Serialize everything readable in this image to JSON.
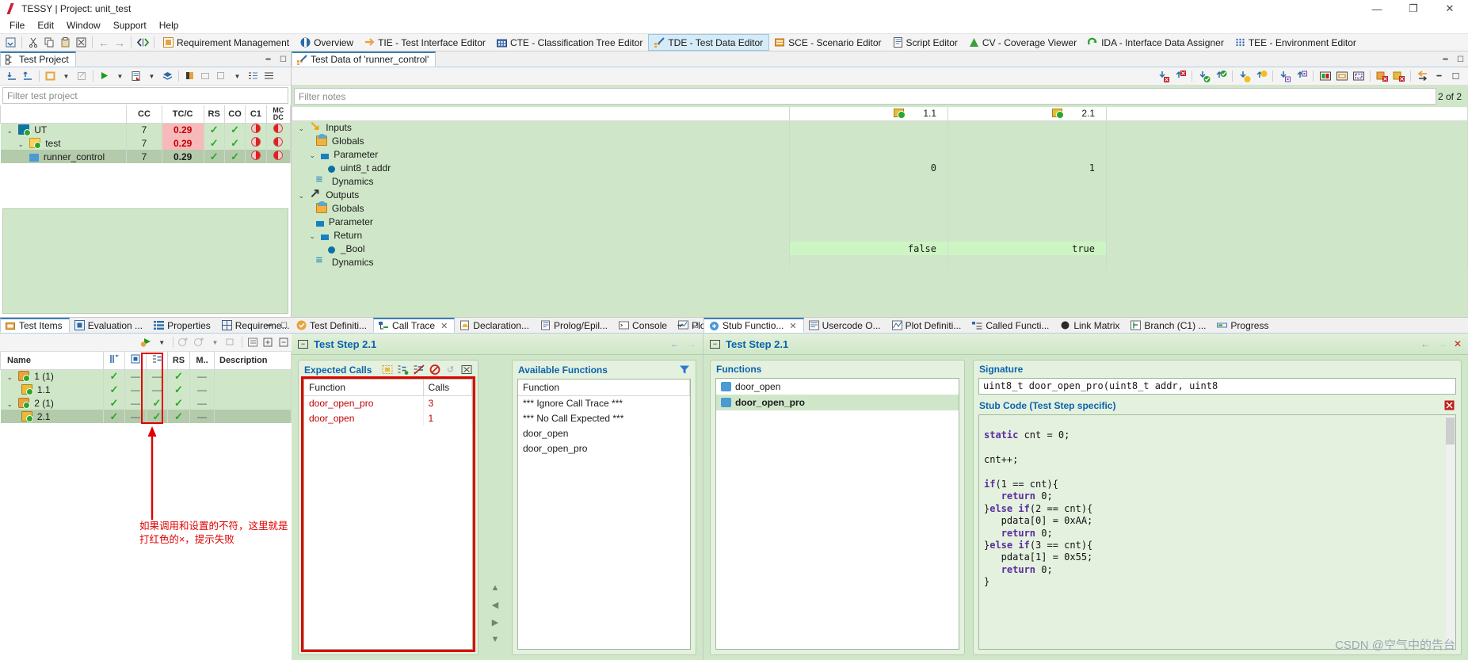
{
  "window": {
    "title": "TESSY | Project: unit_test",
    "minimize": "—",
    "maximize": "❐",
    "close": "✕"
  },
  "menu": [
    "File",
    "Edit",
    "Window",
    "Support",
    "Help"
  ],
  "perspectives": [
    {
      "label": "Requirement Management",
      "icon": "requirement-icon",
      "active": false
    },
    {
      "label": "Overview",
      "icon": "overview-icon",
      "active": false
    },
    {
      "label": "TIE - Test Interface Editor",
      "icon": "tie-icon",
      "active": false
    },
    {
      "label": "CTE - Classification Tree Editor",
      "icon": "cte-icon",
      "active": false
    },
    {
      "label": "TDE - Test Data Editor",
      "icon": "tde-icon",
      "active": true
    },
    {
      "label": "SCE - Scenario Editor",
      "icon": "sce-icon",
      "active": false
    },
    {
      "label": "Script Editor",
      "icon": "script-icon",
      "active": false
    },
    {
      "label": "CV - Coverage Viewer",
      "icon": "cv-icon",
      "active": false
    },
    {
      "label": "IDA - Interface Data Assigner",
      "icon": "ida-icon",
      "active": false
    },
    {
      "label": "TEE - Environment Editor",
      "icon": "tee-icon",
      "active": false
    }
  ],
  "test_project": {
    "tab_label": "Test Project",
    "filter_placeholder": "Filter test project",
    "columns": [
      "",
      "CC",
      "TC/C",
      "RS",
      "CO",
      "C1",
      "MC DC"
    ],
    "rows": [
      {
        "indent": 0,
        "expander": "⌄",
        "icon": "module-icon",
        "name": "UT",
        "cc": "7",
        "tcc": "0.29",
        "rs": "check",
        "co": "check",
        "c1": "pie-half",
        "mcdc": "pie-full",
        "selected": false
      },
      {
        "indent": 1,
        "expander": "⌄",
        "icon": "folder-icon",
        "name": "test",
        "cc": "7",
        "tcc": "0.29",
        "rs": "check",
        "co": "check",
        "c1": "pie-half",
        "mcdc": "pie-full",
        "selected": false
      },
      {
        "indent": 2,
        "expander": "",
        "icon": "function-icon",
        "name": "runner_control",
        "cc": "7",
        "tcc": "0.29",
        "rs": "check",
        "co": "check",
        "c1": "pie-half",
        "mcdc": "pie-full",
        "selected": true
      }
    ]
  },
  "test_data_editor": {
    "tab_label": "Test Data of 'runner_control'",
    "filter_placeholder": "Filter notes",
    "pager": "2 of 2",
    "step_columns": [
      "1.1",
      "2.1"
    ],
    "tree": [
      {
        "indent": 0,
        "expander": "⌄",
        "icon": "inputs-icon",
        "name": "Inputs",
        "v1": "",
        "v2": ""
      },
      {
        "indent": 1,
        "expander": "",
        "icon": "globals-icon",
        "name": "Globals",
        "v1": "",
        "v2": ""
      },
      {
        "indent": 1,
        "expander": "⌄",
        "icon": "parameter-icon",
        "name": "Parameter",
        "v1": "",
        "v2": ""
      },
      {
        "indent": 2,
        "expander": "",
        "icon": "variable-icon",
        "name": "uint8_t addr",
        "v1": "0",
        "v2": "1"
      },
      {
        "indent": 1,
        "expander": "",
        "icon": "dynamics-icon",
        "name": "Dynamics",
        "v1": "",
        "v2": ""
      },
      {
        "indent": 0,
        "expander": "⌄",
        "icon": "outputs-icon",
        "name": "Outputs",
        "v1": "",
        "v2": ""
      },
      {
        "indent": 1,
        "expander": "",
        "icon": "globals-icon",
        "name": "Globals",
        "v1": "",
        "v2": ""
      },
      {
        "indent": 1,
        "expander": "",
        "icon": "parameter-icon",
        "name": "Parameter",
        "v1": "",
        "v2": ""
      },
      {
        "indent": 1,
        "expander": "⌄",
        "icon": "return-icon",
        "name": "Return",
        "v1": "",
        "v2": ""
      },
      {
        "indent": 2,
        "expander": "",
        "icon": "variable-icon",
        "name": "_Bool",
        "v1": "false",
        "v2": "true",
        "highlight": true
      },
      {
        "indent": 1,
        "expander": "",
        "icon": "dynamics-icon",
        "name": "Dynamics",
        "v1": "",
        "v2": ""
      }
    ]
  },
  "test_items": {
    "tabs": [
      {
        "label": "Test Items",
        "icon": "test-items-icon",
        "active": true
      },
      {
        "label": "Evaluation ...",
        "icon": "evaluation-icon",
        "active": false
      },
      {
        "label": "Properties",
        "icon": "properties-icon",
        "active": false
      },
      {
        "label": "Requireme...",
        "icon": "requirements-icon",
        "active": false
      }
    ],
    "columns": [
      "Name",
      "",
      "",
      "",
      "RS",
      "M..",
      "Description"
    ],
    "rows": [
      {
        "indent": 0,
        "expander": "⌄",
        "icon": "testcase-icon",
        "name": "1 (1)",
        "c1": "check",
        "c2": "dash",
        "c3": "dash",
        "rs": "check",
        "m": "dash",
        "description": "",
        "selected": false
      },
      {
        "indent": 1,
        "expander": "",
        "icon": "teststep-icon",
        "name": "1.1",
        "c1": "check",
        "c2": "dash",
        "c3": "dash",
        "rs": "check",
        "m": "dash",
        "description": "",
        "selected": false
      },
      {
        "indent": 0,
        "expander": "⌄",
        "icon": "testcase-icon",
        "name": "2 (1)",
        "c1": "check",
        "c2": "dash",
        "c3": "check",
        "rs": "check",
        "m": "dash",
        "description": "",
        "selected": false
      },
      {
        "indent": 1,
        "expander": "",
        "icon": "teststep-icon",
        "name": "2.1",
        "c1": "check",
        "c2": "dash",
        "c3": "check",
        "rs": "check",
        "m": "dash",
        "description": "",
        "selected": true
      }
    ],
    "annotation_line1": "如果调用和设置的不符，这里就是",
    "annotation_line2": "打红色的×，提示失败"
  },
  "call_trace": {
    "tabs": [
      {
        "label": "Test Definiti...",
        "icon": "test-definition-icon",
        "active": false
      },
      {
        "label": "Call Trace",
        "icon": "call-trace-icon",
        "active": true,
        "closeable": true
      },
      {
        "label": "Declaration...",
        "icon": "declaration-icon",
        "active": false
      },
      {
        "label": "Prolog/Epil...",
        "icon": "prolog-epilog-icon",
        "active": false
      },
      {
        "label": "Console",
        "icon": "console-icon",
        "active": false
      },
      {
        "label": "Plots",
        "icon": "plots-icon",
        "active": false
      }
    ],
    "step_title": "Test Step 2.1",
    "expected_calls": {
      "title": "Expected Calls",
      "columns": [
        "Function",
        "Calls"
      ],
      "rows": [
        {
          "function": "door_open_pro",
          "calls": "3"
        },
        {
          "function": "door_open",
          "calls": "1"
        }
      ]
    },
    "available_functions": {
      "title": "Available Functions",
      "column": "Function",
      "rows": [
        "*** Ignore Call Trace ***",
        "*** No Call Expected ***",
        "door_open",
        "door_open_pro"
      ]
    }
  },
  "stub_functions": {
    "tabs": [
      {
        "label": "Stub Functio...",
        "icon": "stub-functions-icon",
        "active": true,
        "closeable": true
      },
      {
        "label": "Usercode O...",
        "icon": "usercode-icon",
        "active": false
      },
      {
        "label": "Plot Definiti...",
        "icon": "plot-definition-icon",
        "active": false
      },
      {
        "label": "Called Functi...",
        "icon": "called-functions-icon",
        "active": false
      },
      {
        "label": "Link Matrix",
        "icon": "link-matrix-icon",
        "active": false
      },
      {
        "label": "Branch (C1) ...",
        "icon": "branch-icon",
        "active": false
      },
      {
        "label": "Progress",
        "icon": "progress-icon",
        "active": false
      }
    ],
    "step_title": "Test Step 2.1",
    "functions_title": "Functions",
    "functions": [
      {
        "name": "door_open",
        "selected": false
      },
      {
        "name": "door_open_pro",
        "selected": true
      }
    ],
    "signature_title": "Signature",
    "signature": "uint8_t door_open_pro(uint8_t addr, uint8",
    "stub_code_title": "Stub Code (Test Step specific)",
    "stub_code_lines": [
      "static cnt = 0;",
      "",
      "cnt++;",
      "",
      "if(1 == cnt){",
      "   return 0;",
      "}else if(2 == cnt){",
      "   pdata[0] = 0xAA;",
      "   return 0;",
      "}else if(3 == cnt){",
      "   pdata[1] = 0x55;",
      "   return 0;",
      "}"
    ]
  },
  "watermark": "CSDN @空气中的告台"
}
